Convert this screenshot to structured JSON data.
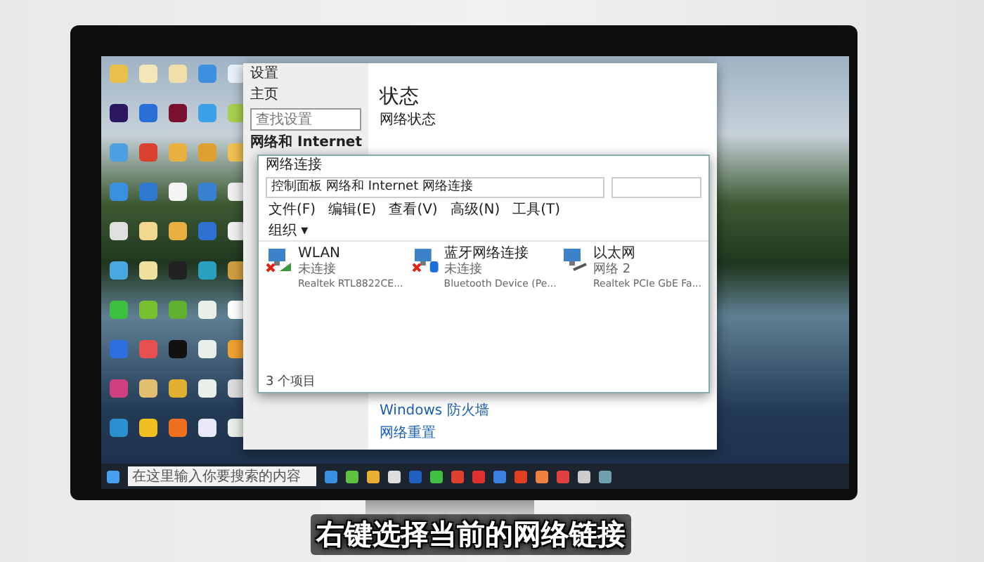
{
  "settings_window": {
    "title": "设置",
    "home": "主页",
    "search": {
      "placeholder": "查找设置"
    },
    "section": "网络和 Internet",
    "heading": "状态",
    "subheading": "网络状态",
    "links": [
      "Windows 防火墙",
      "网络重置"
    ]
  },
  "network_window": {
    "title": "网络连接",
    "breadcrumb": [
      "控制面板",
      "网络和 Internet",
      "网络连接"
    ],
    "menu": [
      "文件(F)",
      "编辑(E)",
      "查看(V)",
      "高级(N)",
      "工具(T)"
    ],
    "organize": "组织 ▾",
    "connections": [
      {
        "kind": "wifi",
        "name": "WLAN",
        "status": "未连接",
        "adapter": "Realtek RTL8822CE...",
        "disconnected": true
      },
      {
        "kind": "bluetooth",
        "name": "蓝牙网络连接",
        "status": "未连接",
        "adapter": "Bluetooth Device (Pe...",
        "disconnected": true
      },
      {
        "kind": "ethernet",
        "name": "以太网",
        "status": "网络 2",
        "adapter": "Realtek PCIe GbE Fa...",
        "disconnected": false
      }
    ],
    "status_bar": "3 个项目"
  },
  "taskbar": {
    "search_placeholder": "在这里输入你要搜索的内容"
  },
  "subtitle": "右键选择当前的网络链接"
}
